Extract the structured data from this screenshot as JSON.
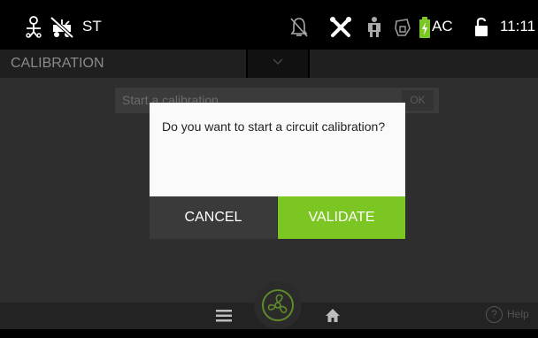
{
  "status_bar": {
    "mode_label": "ST",
    "power_label": "AC",
    "time": "11:11",
    "icons": [
      "patient-icon",
      "no-circuit-icon",
      "alarm-silenced-icon",
      "tools-icon",
      "nurse-call-icon",
      "mask-icon",
      "battery-charging-icon",
      "unlocked-icon"
    ]
  },
  "menu": {
    "title": "CALIBRATION"
  },
  "content": {
    "start_field_label": "Start a calibration",
    "ok_label": "OK"
  },
  "dialog": {
    "message": "Do you want to start a circuit calibration?",
    "cancel_label": "CANCEL",
    "validate_label": "VALIDATE"
  },
  "bottom_nav": {
    "help_label": "Help",
    "help_glyph": "?",
    "icons": [
      "menu-icon",
      "fan-icon",
      "home-icon",
      "help-icon"
    ]
  },
  "colors": {
    "accent": "#7cc623",
    "background": "#000000",
    "overlay": "#2e2e2e",
    "dialog": "#fafafa",
    "cancel": "#3a3a3a"
  }
}
